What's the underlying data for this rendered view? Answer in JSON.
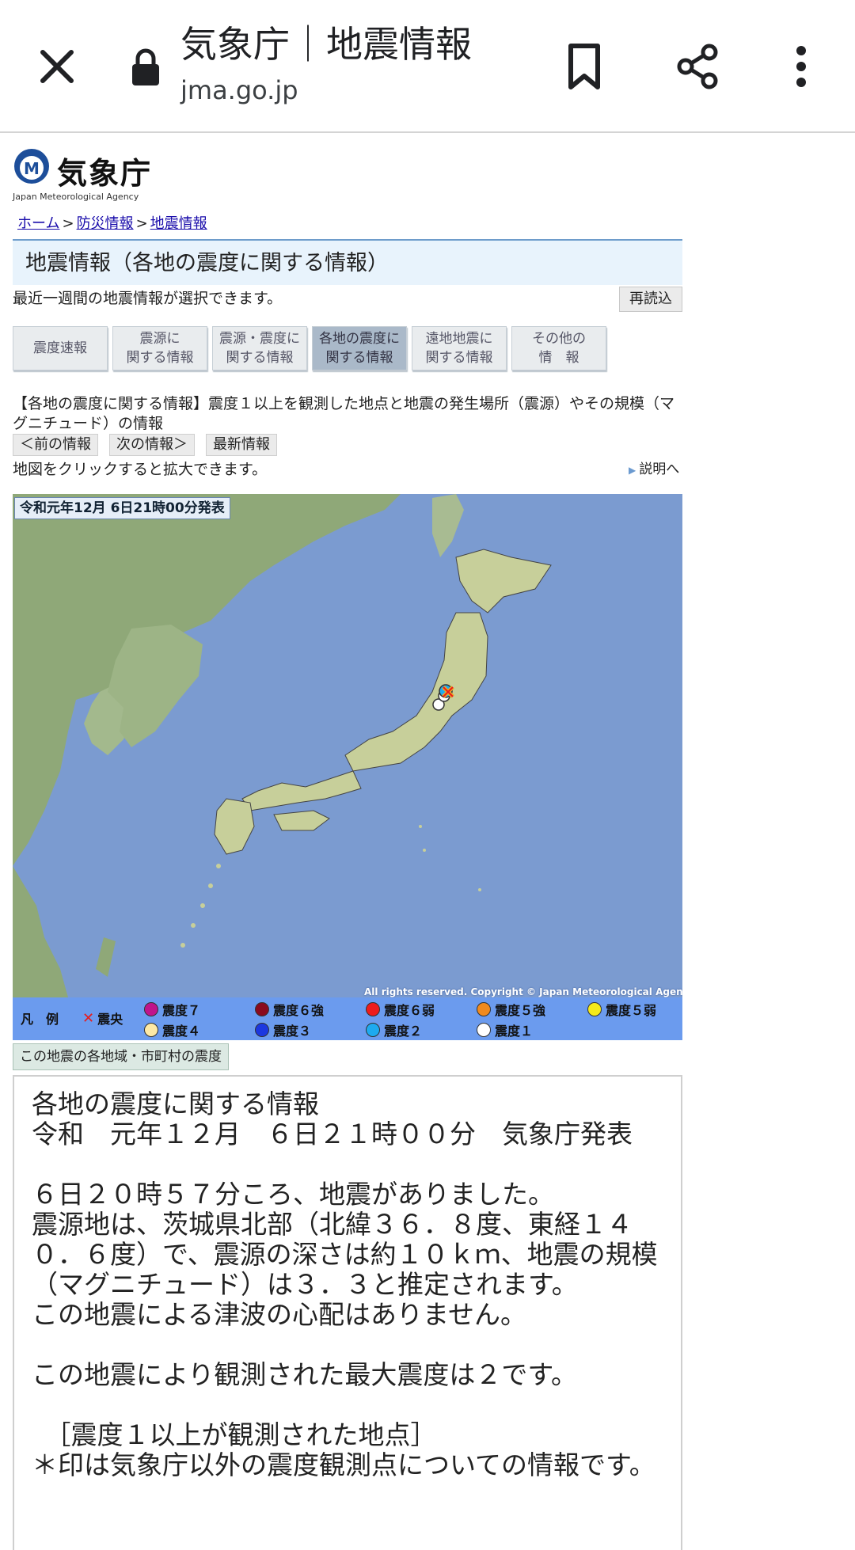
{
  "browser": {
    "title": "気象庁｜地震情報",
    "url": "jma.go.jp",
    "icons": [
      "close-icon",
      "lock-icon",
      "bookmark-icon",
      "share-icon",
      "more-vert-icon"
    ]
  },
  "site": {
    "logo_text": "気象庁",
    "logo_sub": "Japan Meteorological Agency"
  },
  "breadcrumb": {
    "home": "ホーム",
    "sep": ">",
    "disaster": "防災情報",
    "quake": "地震情報"
  },
  "heading": "地震情報（各地の震度に関する情報）",
  "intro": "最近一週間の地震情報が選択できます。",
  "reload": "再読込",
  "tabs": [
    {
      "label": "震度速報"
    },
    {
      "label": "震源に\n関する情報"
    },
    {
      "label": "震源・震度に\n関する情報"
    },
    {
      "label": "各地の震度に\n関する情報"
    },
    {
      "label": "遠地地震に\n関する情報"
    },
    {
      "label": "その他の\n情　報"
    }
  ],
  "description": "【各地の震度に関する情報】震度１以上を観測した地点と地震の発生場所（震源）やその規模（マグニチュード）の情報",
  "nav": {
    "prev": "＜前の情報",
    "next": "次の情報＞",
    "latest": "最新情報"
  },
  "zoom_note": "地図をクリックすると拡大できます。",
  "explain": "説明へ",
  "map": {
    "issued": "令和元年12月 6日21時00分発表",
    "copyright": "All rights reserved. Copyright © Japan Meteorological Agency",
    "legend_title": "凡　例",
    "epicenter_label": "震央",
    "legend": [
      {
        "label": "震度７",
        "color": "#c0148c"
      },
      {
        "label": "震度６強",
        "color": "#8a0a1e"
      },
      {
        "label": "震度６弱",
        "color": "#ee1c1c"
      },
      {
        "label": "震度５強",
        "color": "#f08a1e"
      },
      {
        "label": "震度５弱",
        "color": "#f5ea1a"
      },
      {
        "label": "震度４",
        "color": "#fde9a6"
      },
      {
        "label": "震度３",
        "color": "#1c38e0"
      },
      {
        "label": "震度２",
        "color": "#1eaaf0"
      },
      {
        "label": "震度１",
        "color": "#ffffff"
      }
    ]
  },
  "region_tab": "この地震の各地域・市町村の震度",
  "report": {
    "lines": [
      "各地の震度に関する情報",
      "令和　元年１２月　６日２１時００分　気象庁発表",
      "",
      "６日２０時５７分ころ、地震がありました。",
      "震源地は、茨城県北部（北緯３６．８度、東経１４０．６度）で、震源の深さは約１０ｋｍ、地震の規模（マグニチュード）は３．３と推定されます。",
      "この地震による津波の心配はありません。",
      "",
      "この地震により観測された最大震度は２です。",
      "",
      "　［震度１以上が観測された地点］",
      "＊印は気象庁以外の震度観測点についての情報です。"
    ]
  }
}
